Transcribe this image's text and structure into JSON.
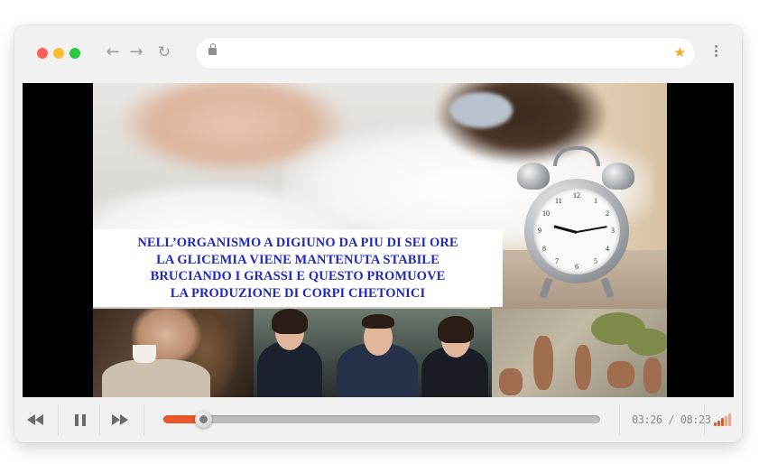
{
  "browser": {
    "url": "",
    "traffic_lights": [
      "#ff5f57",
      "#febc2e",
      "#28c840"
    ],
    "icons": {
      "back": "arrow-left-icon",
      "forward": "arrow-right-icon",
      "reload": "reload-icon",
      "lock": "lock-icon",
      "bookmark": "star-icon",
      "menu": "kebab-menu-icon"
    }
  },
  "video": {
    "caption_lines": [
      "NELL’ORGANISMO A DIGIUNO DA PIU DI SEI ORE",
      "LA GLICEMIA VIENE MANTENUTA STABILE",
      "BRUCIANDO I GRASSI E QUESTO PROMUOVE",
      "LA PRODUZIONE DI CORPI CHETONICI"
    ],
    "caption_color": "#1f2ab8"
  },
  "player": {
    "current_time": "03:26",
    "duration": "08:23",
    "time_display": "03:26 / 08:23",
    "progress_fraction": 0.09,
    "accent_color": "#e8562a",
    "signal_levels": 5,
    "signal_active": 3
  }
}
